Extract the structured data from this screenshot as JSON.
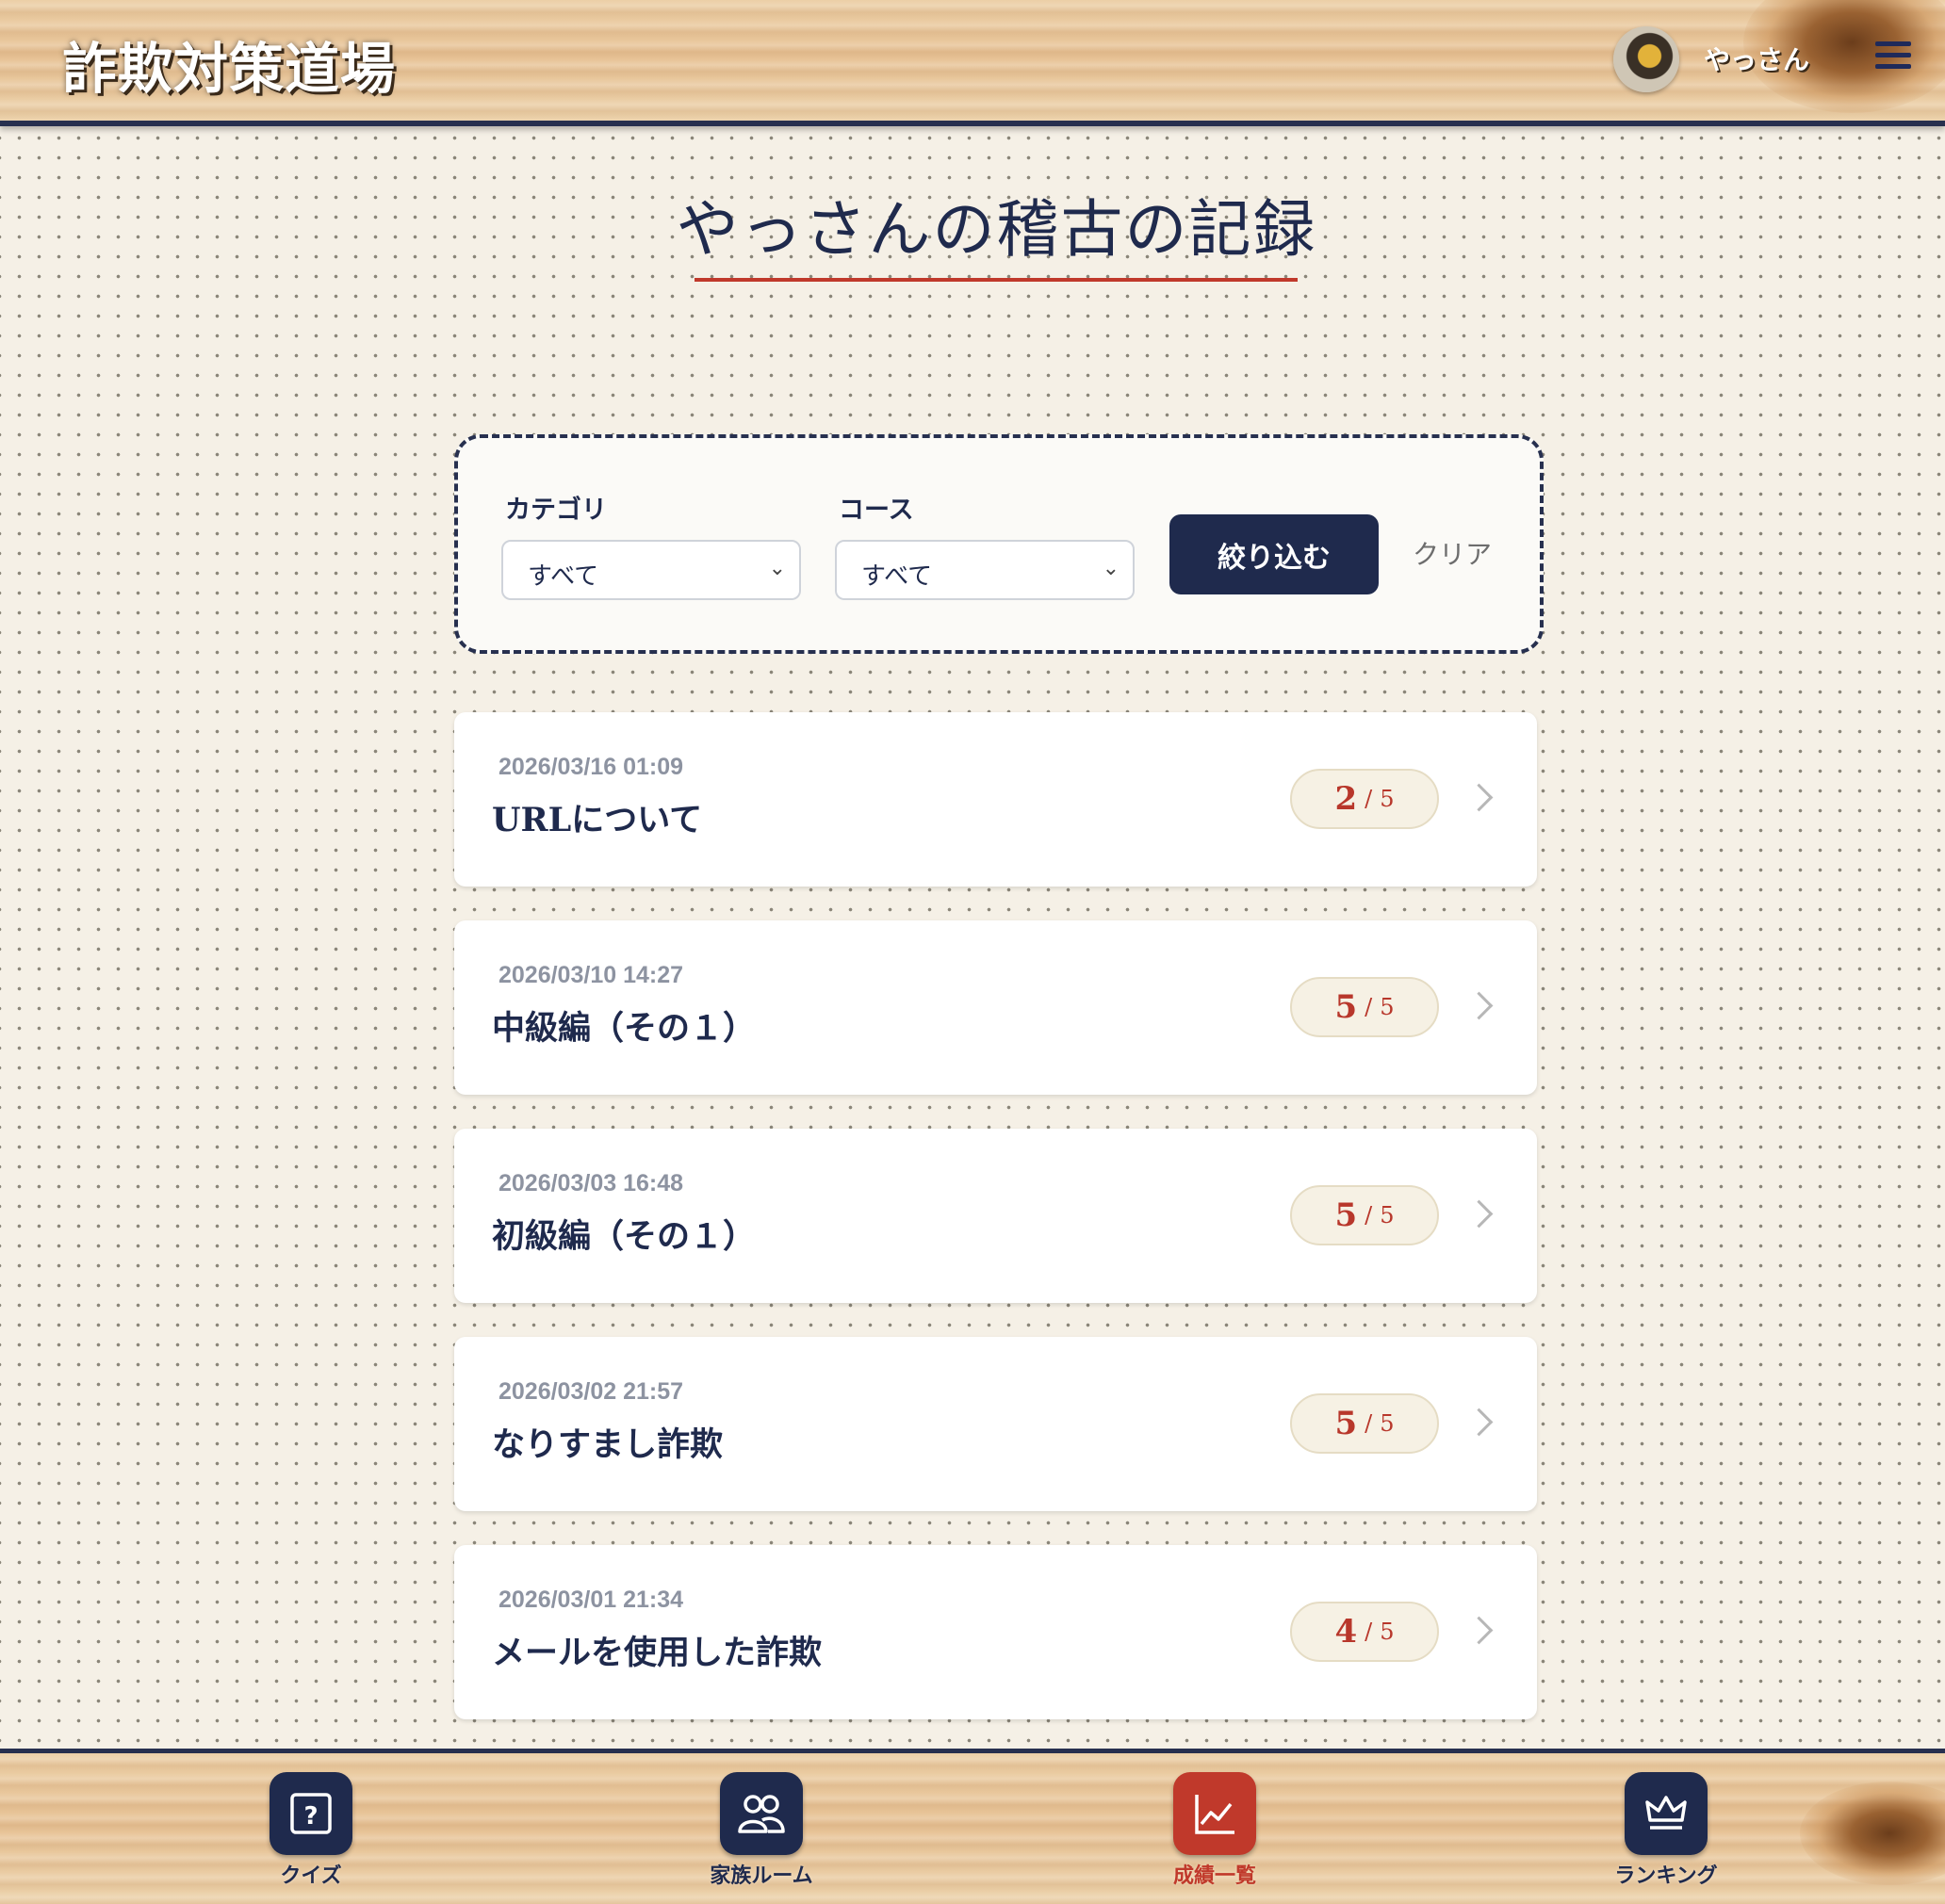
{
  "header": {
    "logo": "詐欺対策道場",
    "username": "やっさん"
  },
  "page": {
    "title": "やっさんの稽古の記録"
  },
  "filter": {
    "category_label": "カテゴリ",
    "category_value": "すべて",
    "course_label": "コース",
    "course_value": "すべて",
    "apply_label": "絞り込む",
    "clear_label": "クリア"
  },
  "records": [
    {
      "date": "2026/03/16 01:09",
      "title": "URLについて",
      "score": "2",
      "sep": "/",
      "total": "5"
    },
    {
      "date": "2026/03/10 14:27",
      "title": "中級編（その１）",
      "score": "5",
      "sep": "/",
      "total": "5"
    },
    {
      "date": "2026/03/03 16:48",
      "title": "初級編（その１）",
      "score": "5",
      "sep": "/",
      "total": "5"
    },
    {
      "date": "2026/03/02 21:57",
      "title": "なりすまし詐欺",
      "score": "5",
      "sep": "/",
      "total": "5"
    },
    {
      "date": "2026/03/01 21:34",
      "title": "メールを使用した詐欺",
      "score": "4",
      "sep": "/",
      "total": "5"
    }
  ],
  "nav": [
    {
      "label": "クイズ",
      "icon": "question-icon",
      "active": false
    },
    {
      "label": "家族ルーム",
      "icon": "people-icon",
      "active": false
    },
    {
      "label": "成績一覧",
      "icon": "chart-icon",
      "active": true
    },
    {
      "label": "ランキング",
      "icon": "crown-icon",
      "active": false
    }
  ],
  "colors": {
    "navy": "#1f2a4d",
    "accent_red": "#c0392b",
    "paper": "#f5f0e6"
  }
}
